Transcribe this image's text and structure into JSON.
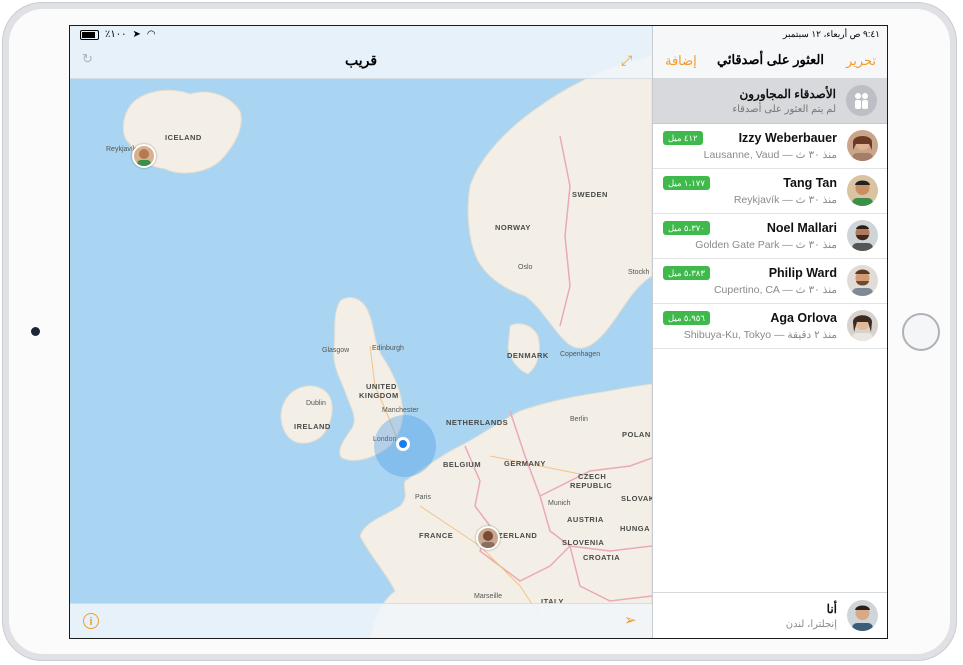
{
  "status_bar": {
    "battery": "٪١٠٠",
    "time_date": "٩:٤١ ص  أربعاء، ١٢ سبتمبر"
  },
  "map": {
    "title": "قريب",
    "icons": {
      "refresh": "refresh-icon",
      "expand": "expand-icon",
      "info": "info-icon",
      "location": "location-arrow-icon"
    },
    "country_labels": [
      "ICELAND",
      "SWEDEN",
      "NORWAY",
      "DENMARK",
      "UNITED",
      "KINGDOM",
      "IRELAND",
      "NETHERLANDS",
      "POLAN",
      "BELGIUM",
      "GERMANY",
      "CZECH",
      "REPUBLIC",
      "SLOVAK",
      "AUSTRIA",
      "HUNGA",
      "FRANCE",
      "ZERLAND",
      "SLOVENIA",
      "CROATIA",
      "ITALY"
    ],
    "city_labels": [
      "Reykjavík",
      "Oslo",
      "Stockh",
      "Glasgow",
      "Edinburgh",
      "Copenhagen",
      "Dublin",
      "Manchester",
      "London",
      "Berlin",
      "Paris",
      "Munich",
      "Marseille"
    ]
  },
  "sidebar": {
    "edit_label": "تحرير",
    "title": "العثور على أصدقائي",
    "add_label": "إضافة",
    "nearby": {
      "title": "الأصدقاء المجاورون",
      "subtitle": "لم يتم العثور على أصدقاء"
    },
    "friends": [
      {
        "name": "Izzy Weberbauer",
        "location": "Lausanne, Vaud — منذ ٣٠ ث",
        "distance": "٤١٢ ميل"
      },
      {
        "name": "Tang Tan",
        "location": "Reykjavík — منذ ٣٠ ث",
        "distance": "١،١٧٧ ميل"
      },
      {
        "name": "Noel Mallari",
        "location": "Golden Gate Park — منذ ٣٠ ث",
        "distance": "٥،٣٧٠ ميل"
      },
      {
        "name": "Philip Ward",
        "location": "Cupertino, CA — منذ ٣٠ ث",
        "distance": "٥،٣٨٣ ميل"
      },
      {
        "name": "Aga Orlova",
        "location": "Shibuya-Ku, Tokyo — منذ ٢ دقيقة",
        "distance": "٥،٩٥٦ ميل"
      }
    ],
    "me": {
      "name": "أنا",
      "location": "إنجلترا، لندن"
    }
  },
  "colors": {
    "accent": "#f39a2b",
    "badge_green": "#3fb94b",
    "water": "#a9d5f2",
    "land": "#f3efe6",
    "border_pink": "#e9a9b6"
  }
}
